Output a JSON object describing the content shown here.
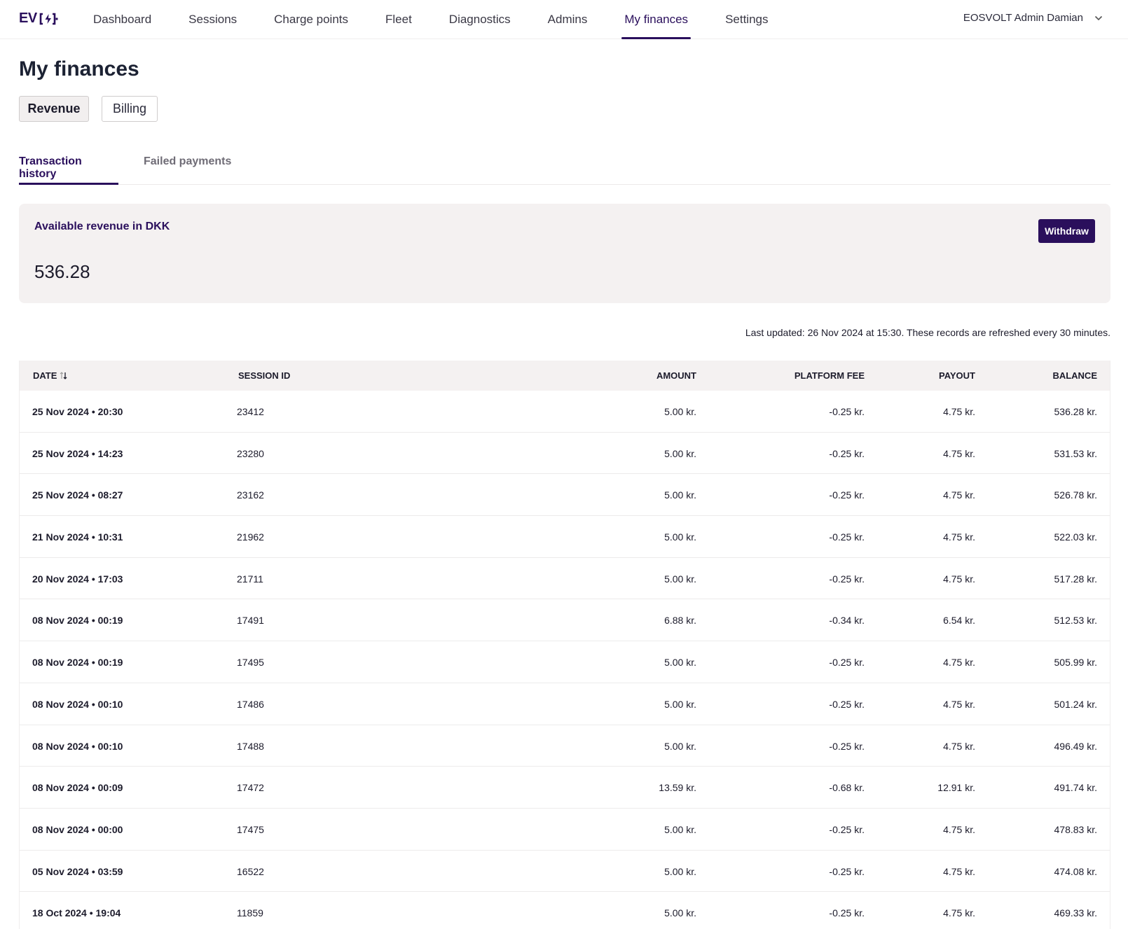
{
  "brand": {
    "logo_text": "EV"
  },
  "nav": {
    "items": [
      "Dashboard",
      "Sessions",
      "Charge points",
      "Fleet",
      "Diagnostics",
      "Admins",
      "My finances",
      "Settings"
    ],
    "active": "My finances"
  },
  "user": {
    "name": "EOSVOLT Admin Damian"
  },
  "page": {
    "title": "My finances"
  },
  "segments": {
    "revenue": "Revenue",
    "billing": "Billing"
  },
  "subtabs": {
    "transaction_history": "Transaction history",
    "failed_payments": "Failed payments"
  },
  "revenue_card": {
    "label": "Available revenue in DKK",
    "value": "536.28",
    "withdraw_label": "Withdraw"
  },
  "last_updated": "Last updated: 26 Nov 2024 at 15:30. These records are refreshed every 30 minutes.",
  "table": {
    "headers": {
      "date": "DATE",
      "session_id": "SESSION ID",
      "amount": "AMOUNT",
      "platform_fee": "PLATFORM FEE",
      "payout": "PAYOUT",
      "balance": "BALANCE"
    },
    "rows": [
      {
        "date": "25 Nov 2024 • 20:30",
        "session_id": "23412",
        "amount": "5.00 kr.",
        "platform_fee": "-0.25 kr.",
        "payout": "4.75 kr.",
        "balance": "536.28 kr."
      },
      {
        "date": "25 Nov 2024 • 14:23",
        "session_id": "23280",
        "amount": "5.00 kr.",
        "platform_fee": "-0.25 kr.",
        "payout": "4.75 kr.",
        "balance": "531.53 kr."
      },
      {
        "date": "25 Nov 2024 • 08:27",
        "session_id": "23162",
        "amount": "5.00 kr.",
        "platform_fee": "-0.25 kr.",
        "payout": "4.75 kr.",
        "balance": "526.78 kr."
      },
      {
        "date": "21 Nov 2024 • 10:31",
        "session_id": "21962",
        "amount": "5.00 kr.",
        "platform_fee": "-0.25 kr.",
        "payout": "4.75 kr.",
        "balance": "522.03 kr."
      },
      {
        "date": "20 Nov 2024 • 17:03",
        "session_id": "21711",
        "amount": "5.00 kr.",
        "platform_fee": "-0.25 kr.",
        "payout": "4.75 kr.",
        "balance": "517.28 kr."
      },
      {
        "date": "08 Nov 2024 • 00:19",
        "session_id": "17491",
        "amount": "6.88 kr.",
        "platform_fee": "-0.34 kr.",
        "payout": "6.54 kr.",
        "balance": "512.53 kr."
      },
      {
        "date": "08 Nov 2024 • 00:19",
        "session_id": "17495",
        "amount": "5.00 kr.",
        "platform_fee": "-0.25 kr.",
        "payout": "4.75 kr.",
        "balance": "505.99 kr."
      },
      {
        "date": "08 Nov 2024 • 00:10",
        "session_id": "17486",
        "amount": "5.00 kr.",
        "platform_fee": "-0.25 kr.",
        "payout": "4.75 kr.",
        "balance": "501.24 kr."
      },
      {
        "date": "08 Nov 2024 • 00:10",
        "session_id": "17488",
        "amount": "5.00 kr.",
        "platform_fee": "-0.25 kr.",
        "payout": "4.75 kr.",
        "balance": "496.49 kr."
      },
      {
        "date": "08 Nov 2024 • 00:09",
        "session_id": "17472",
        "amount": "13.59 kr.",
        "platform_fee": "-0.68 kr.",
        "payout": "12.91 kr.",
        "balance": "491.74 kr."
      },
      {
        "date": "08 Nov 2024 • 00:00",
        "session_id": "17475",
        "amount": "5.00 kr.",
        "platform_fee": "-0.25 kr.",
        "payout": "4.75 kr.",
        "balance": "478.83 kr."
      },
      {
        "date": "05 Nov 2024 • 03:59",
        "session_id": "16522",
        "amount": "5.00 kr.",
        "platform_fee": "-0.25 kr.",
        "payout": "4.75 kr.",
        "balance": "474.08 kr."
      },
      {
        "date": "18 Oct 2024 • 19:04",
        "session_id": "11859",
        "amount": "5.00 kr.",
        "platform_fee": "-0.25 kr.",
        "payout": "4.75 kr.",
        "balance": "469.33 kr."
      }
    ]
  },
  "icons": {
    "logo": "plug-bolt-icon",
    "user_menu": "chevron-down-icon",
    "sort": "sort-icon"
  },
  "colors": {
    "brand": "#2a0f5c",
    "card_bg": "#f4f1f1"
  }
}
